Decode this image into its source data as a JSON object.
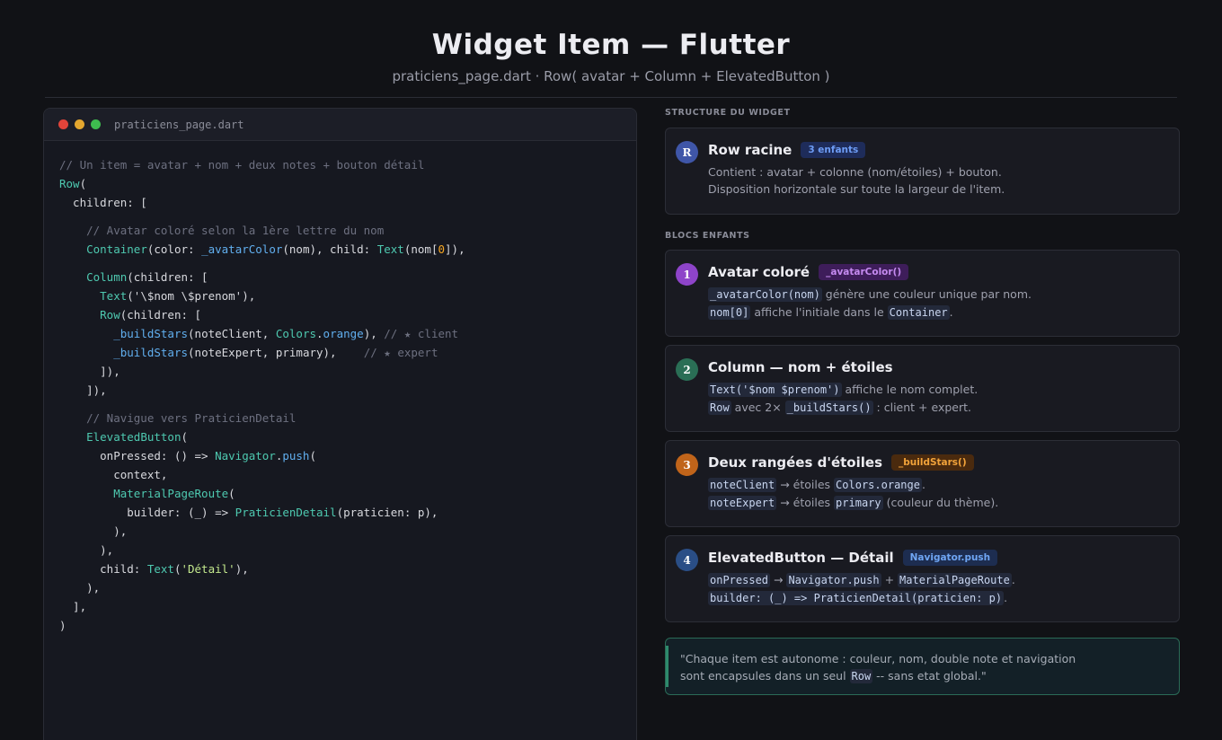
{
  "header": {
    "title": "Widget Item — Flutter",
    "subtitle": "praticiens_page.dart  ·  Row( avatar + Column + ElevatedButton )"
  },
  "code_panel": {
    "filename": "praticiens_page.dart",
    "lines": {
      "l1": "// Un item = avatar + nom + deux notes + bouton détail",
      "l2_type": "Row",
      "l2_rest": "(",
      "l3": "  children: [",
      "l4": "    // Avatar coloré selon la 1ère lettre du nom",
      "l5_a": "Container",
      "l5_b": "(color: ",
      "l5_c": "_avatarColor",
      "l5_d": "(nom), child: ",
      "l5_e": "Text",
      "l5_f": "(nom[",
      "l5_g": "0",
      "l5_h": "]),",
      "l6_a": "Column",
      "l6_b": "(children: [",
      "l7_a": "Text",
      "l7_b": "('\\$nom \\$prenom'),",
      "l8_a": "Row",
      "l8_b": "(children: [",
      "l9_a": "_buildStars",
      "l9_b": "(noteClient, ",
      "l9_c": "Colors",
      "l9_d": ".",
      "l9_e": "orange",
      "l9_f": "), ",
      "l9_g": "// ★ client",
      "l10_a": "_buildStars",
      "l10_b": "(noteExpert, primary),    ",
      "l10_c": "// ★ expert",
      "l11": "      ]),",
      "l12": "    ]),",
      "l13": "    // Navigue vers PraticienDetail",
      "l14_a": "ElevatedButton",
      "l14_b": "(",
      "l15_a": "      onPressed: () => ",
      "l15_b": "Navigator",
      "l15_c": ".",
      "l15_d": "push",
      "l15_e": "(",
      "l16": "        context,",
      "l17_a": "MaterialPageRoute",
      "l17_b": "(",
      "l18_a": "          builder: (_) => ",
      "l18_b": "PraticienDetail",
      "l18_c": "(praticien: p),",
      "l19": "        ),",
      "l20": "      ),",
      "l21_a": "      child: ",
      "l21_b": "Text",
      "l21_c": "(",
      "l21_d": "'Détail'",
      "l21_e": "),",
      "l22": "    ),",
      "l23": "  ],",
      "l24": ")"
    }
  },
  "structure": {
    "label": "STRUCTURE DU WIDGET",
    "root": {
      "badge": "R",
      "title": "Row racine",
      "tag": "3 enfants",
      "desc1": "Contient : avatar + colonne (nom/étoiles) + bouton.",
      "desc2": "Disposition horizontale sur toute la largeur de l'item."
    }
  },
  "children_section": {
    "label": "BLOCS ENFANTS",
    "avatar": {
      "badge": "1",
      "title": "Avatar coloré",
      "tag": "_avatarColor()",
      "code1": "_avatarColor(nom)",
      "text1": " génère une couleur unique par nom.",
      "code2": "nom[0]",
      "text2": " affiche l'initiale dans le ",
      "code3": "Container",
      "text3": "."
    },
    "column": {
      "badge": "2",
      "title": "Column — nom + étoiles",
      "code1": "Text('$nom $prenom')",
      "text1": " affiche le nom complet.",
      "code2": "Row",
      "text2": " avec 2× ",
      "code3": "_buildStars()",
      "text3": " : client + expert."
    },
    "stars": {
      "badge": "3",
      "title": "Deux rangées d'étoiles",
      "tag": "_buildStars()",
      "code1": "noteClient",
      "text1": " → étoiles ",
      "code2": "Colors.orange",
      "text2": ".",
      "code3": "noteExpert",
      "text3": " → étoiles ",
      "code4": "primary",
      "text4": " (couleur du thème)."
    },
    "button": {
      "badge": "4",
      "title": "ElevatedButton — Détail",
      "tag": "Navigator.push",
      "code1": "onPressed",
      "text1": " → ",
      "code2": "Navigator.push",
      "text2": " + ",
      "code3": "MaterialPageRoute",
      "text3": ".",
      "code4": "builder: (_) => PraticienDetail(praticien: p)",
      "text4": "."
    }
  },
  "quote": {
    "line1": "\"Chaque item est autonome : couleur, nom, double note et navigation",
    "line2a": " sont encapsules dans un seul ",
    "line2code": "Row",
    "line2b": " -- sans etat global.\""
  },
  "colors": {
    "root_badge": "#3f56a8",
    "avatar_badge": "#8e44c9",
    "column_badge": "#2a6e55",
    "stars_badge": "#c0641a",
    "button_badge": "#2a4e86",
    "root_tag_bg": "#1e2c5a",
    "root_tag_fg": "#6d9cf5",
    "avatar_tag_bg": "#3e1d5a",
    "avatar_tag_fg": "#c58af0",
    "stars_tag_bg": "#4a2a0e",
    "stars_tag_fg": "#f2a33a",
    "button_tag_bg": "#1d2d50",
    "button_tag_fg": "#6fa6f4"
  }
}
